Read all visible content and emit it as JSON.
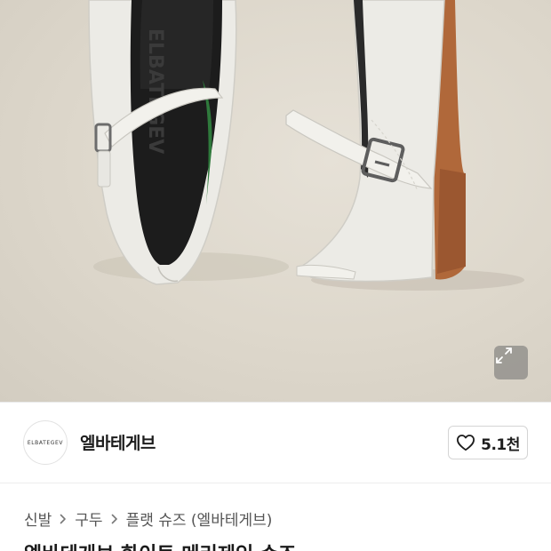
{
  "image": {
    "brand_lettering": "ELBATEGEV"
  },
  "expand": {
    "icon": "expand-arrows-icon"
  },
  "shop": {
    "avatar_text": "ELBATEGEV",
    "name": "엘바테게브",
    "like_icon": "heart-outline-icon",
    "like_count": "5.1천"
  },
  "breadcrumb": {
    "items": [
      "신발",
      "구두",
      "플랫 슈즈 (엘바테게브)"
    ],
    "separator_icon": "chevron-right-icon"
  },
  "product": {
    "title": "엘바테게브 화이트 메리제인 슈즈"
  },
  "colors": {
    "background": "#ddd7cb",
    "shoe_leather": "#ecebe6",
    "sole": "#b0683a",
    "insole": "#1c1c1c",
    "text_primary": "#1d1d1d",
    "text_secondary": "#555555"
  }
}
